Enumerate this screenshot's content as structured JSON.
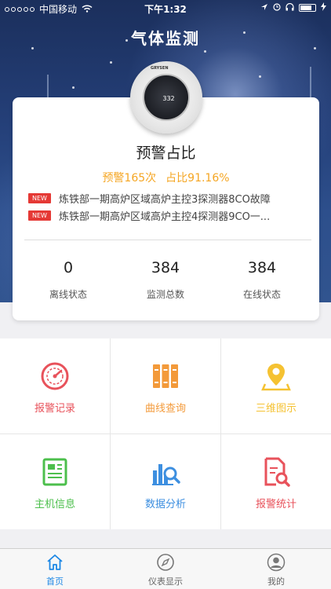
{
  "status_bar": {
    "carrier": "中国移动",
    "time": "下午1:32"
  },
  "header": {
    "title": "气体监测"
  },
  "sensor": {
    "reading": "332",
    "brand": "GRYSEN"
  },
  "card": {
    "title": "预警占比",
    "warnings": "预警165次",
    "ratio": "占比91.16%",
    "news": [
      {
        "badge": "NEW",
        "text": "炼铁部一期高炉区域高炉主控3探测器8CO故障"
      },
      {
        "badge": "NEW",
        "text": "炼铁部一期高炉区域高炉主控4探测器9CO一..."
      }
    ],
    "metrics": [
      {
        "value": "0",
        "label": "离线状态"
      },
      {
        "value": "384",
        "label": "监测总数"
      },
      {
        "value": "384",
        "label": "在线状态"
      }
    ]
  },
  "menu": [
    {
      "label": "报警记录",
      "icon": "gauge-icon",
      "color": "#e8525b"
    },
    {
      "label": "曲线查询",
      "icon": "books-icon",
      "color": "#f39a3a"
    },
    {
      "label": "三维图示",
      "icon": "map-pin-icon",
      "color": "#f5c232"
    },
    {
      "label": "主机信息",
      "icon": "document-icon",
      "color": "#4cbf4c"
    },
    {
      "label": "数据分析",
      "icon": "chart-search-icon",
      "color": "#3d8fe0"
    },
    {
      "label": "报警统计",
      "icon": "file-search-icon",
      "color": "#e8525b"
    }
  ],
  "tabs": [
    {
      "label": "首页",
      "icon": "home-icon",
      "active": true
    },
    {
      "label": "仪表显示",
      "icon": "compass-icon",
      "active": false
    },
    {
      "label": "我的",
      "icon": "user-icon",
      "active": false
    }
  ],
  "colors": {
    "accent": "#1e88e5",
    "warning": "#f5a623",
    "badge": "#e53935"
  }
}
